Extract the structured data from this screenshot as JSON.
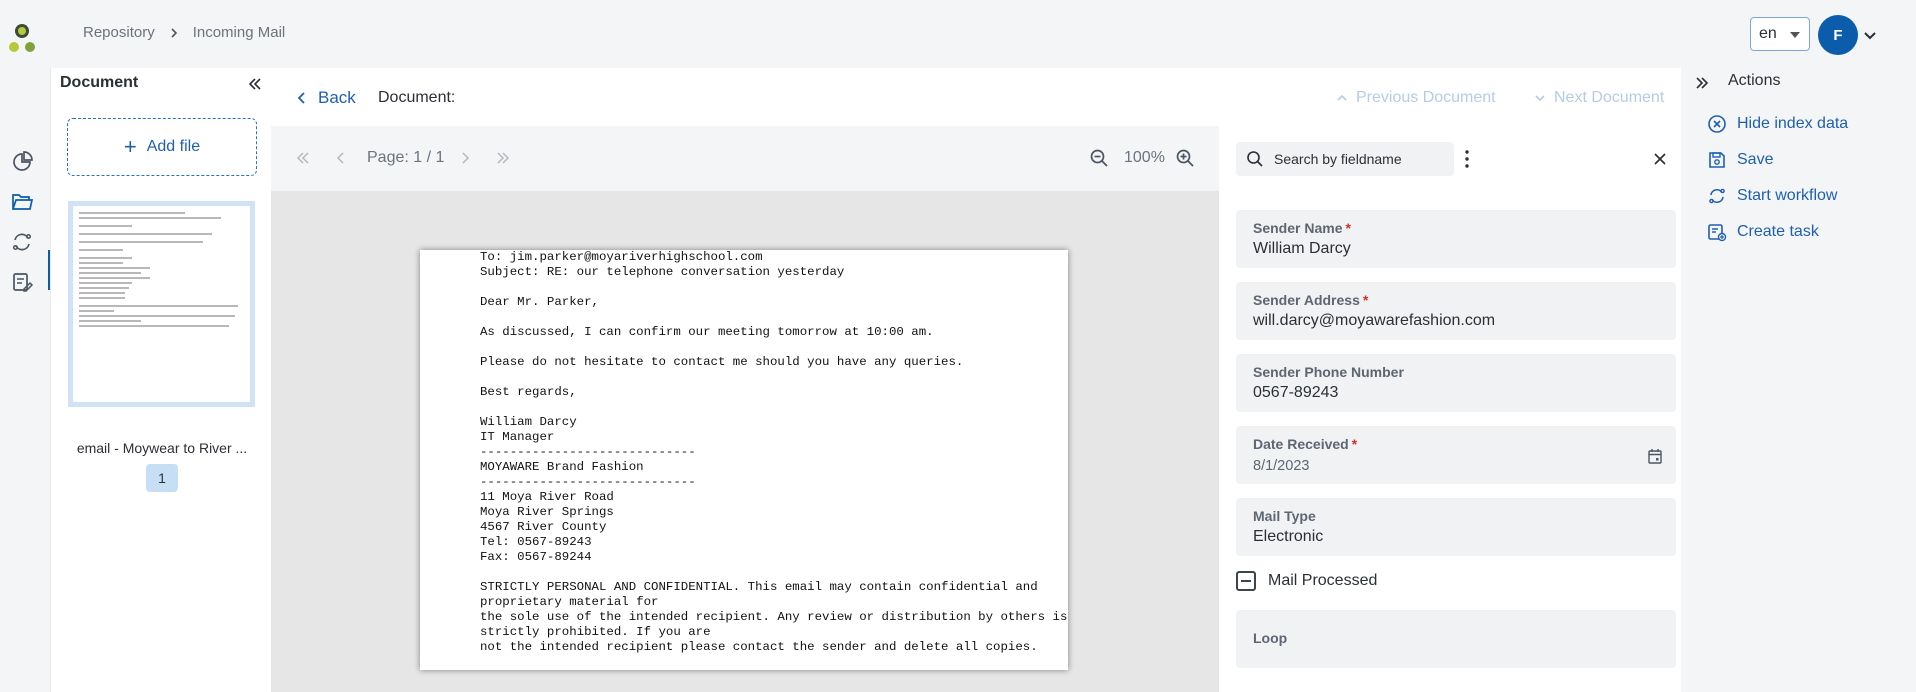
{
  "header": {
    "breadcrumb": [
      "Repository",
      "Incoming Mail"
    ],
    "language": "en",
    "avatar_initial": "F"
  },
  "document_panel": {
    "title": "Document",
    "add_file_label": "Add file",
    "thumbnail_caption": "email - Moywear to River ...",
    "thumbnail_page": "1"
  },
  "doc_header": {
    "back_label": "Back",
    "document_label": "Document:",
    "previous_label": "Previous Document",
    "next_label": "Next Document"
  },
  "viewer": {
    "page_label": "Page: 1 / 1",
    "zoom": "100%",
    "content": "To: jim.parker@moyariverhighschool.com\nSubject: RE: our telephone conversation yesterday\n\nDear Mr. Parker,\n\nAs discussed, I can confirm our meeting tomorrow at 10:00 am.\n\nPlease do not hesitate to contact me should you have any queries.\n\nBest regards,\n\nWilliam Darcy\nIT Manager\n-----------------------------\nMOYAWARE Brand Fashion\n-----------------------------\n11 Moya River Road\nMoya River Springs\n4567 River County\nTel: 0567-89243\nFax: 0567-89244\n\nSTRICTLY PERSONAL AND CONFIDENTIAL. This email may contain confidential and\nproprietary material for\nthe sole use of the intended recipient. Any review or distribution by others is\nstrictly prohibited. If you are\nnot the intended recipient please contact the sender and delete all copies."
  },
  "index": {
    "search_placeholder": "Search by fieldname",
    "fields": [
      {
        "label": "Sender Name",
        "required": "*",
        "value": "William Darcy"
      },
      {
        "label": "Sender Address",
        "required": "*",
        "value": "will.darcy@moyawarefashion.com"
      },
      {
        "label": "Sender Phone Number",
        "value": "0567-89243"
      },
      {
        "label": "Date Received",
        "required": "*",
        "value": "8/1/2023"
      },
      {
        "label": "Mail Type",
        "value": "Electronic"
      },
      {
        "label": "Loop",
        "value": ""
      }
    ],
    "mail_processed_label": "Mail Processed"
  },
  "actions": {
    "title": "Actions",
    "items": [
      {
        "label": "Hide index data",
        "icon": "hide-circle-x-icon"
      },
      {
        "label": "Save",
        "icon": "save-floppy-icon"
      },
      {
        "label": "Start workflow",
        "icon": "workflow-cycle-icon"
      },
      {
        "label": "Create task",
        "icon": "create-task-icon"
      }
    ]
  },
  "colors": {
    "accent": "#1f5fb0",
    "avatar": "#0b5cab",
    "required": "#d32f2f",
    "selection": "#cfe2f6"
  }
}
